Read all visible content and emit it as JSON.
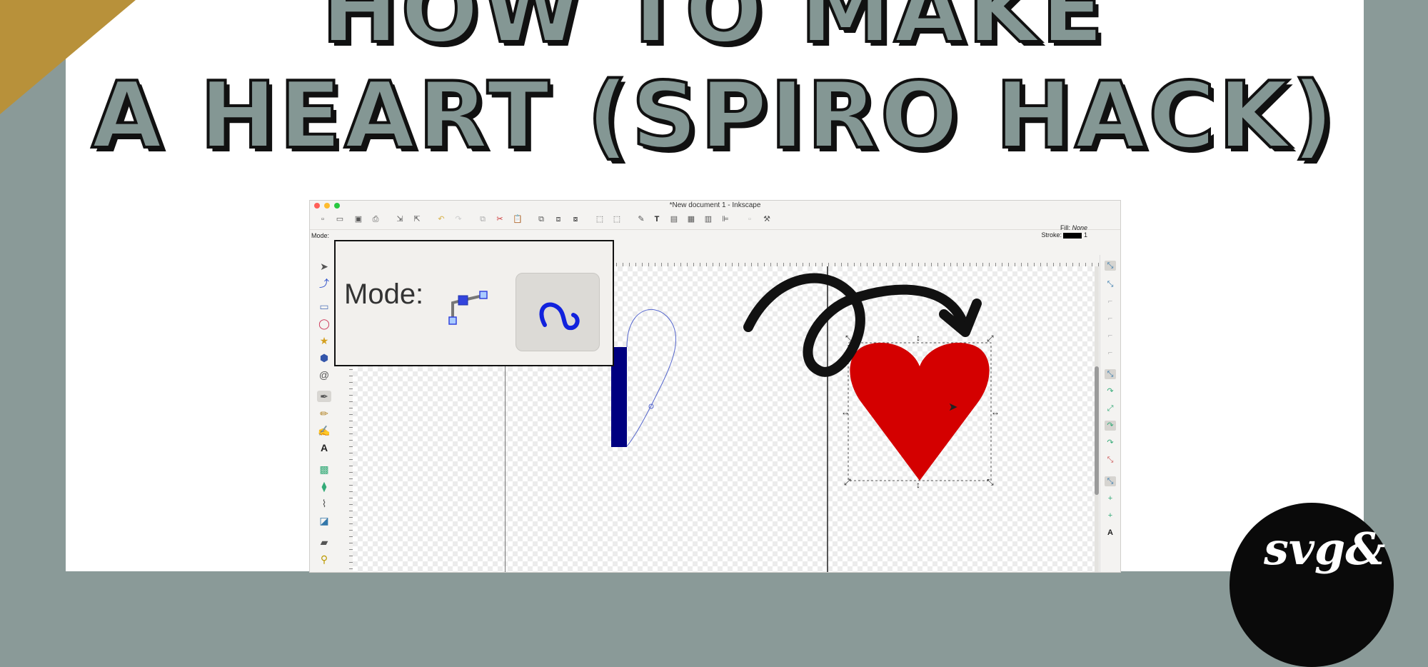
{
  "title": {
    "line1": "HOW TO MAKE",
    "line2": "A HEART (SPIRO HACK)"
  },
  "window": {
    "title": "*New document 1 - Inkscape",
    "mode_label": "Mode:",
    "fill_label": "Fill:",
    "fill_value": "None",
    "stroke_label": "Stroke:",
    "stroke_width": "1"
  },
  "callout": {
    "mode_label": "Mode:",
    "active_mode": "spiro-path-icon"
  },
  "colors": {
    "title_fill": "#849794",
    "background": "#8a9a98",
    "heart": "#d40000",
    "rect": "#000080"
  },
  "logo": {
    "text": "svg&"
  }
}
